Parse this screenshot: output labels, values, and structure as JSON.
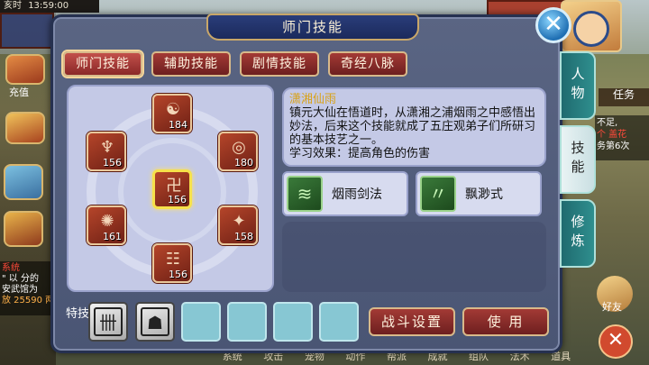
{
  "status_bar": {
    "left_text": "亥时",
    "time": "13:59:00"
  },
  "background": {
    "left_hud_label": "充值",
    "chat_lines": [
      "系统",
      "\" 以 分的",
      "安武馆为",
      "放 25590 两"
    ],
    "right_task_label": "任务",
    "right_notice": [
      "不足,",
      "个 盖花",
      "务第6次"
    ],
    "bottom_menu": [
      "系统",
      "攻击",
      "宠物",
      "动作",
      "帮派",
      "成就",
      "组队",
      "法术",
      "道具"
    ],
    "right_bottom_label": "好友"
  },
  "dialog": {
    "title": "师门技能",
    "close_label": "✕"
  },
  "top_tabs": [
    {
      "label": "师门技能",
      "active": true
    },
    {
      "label": "辅助技能",
      "active": false
    },
    {
      "label": "剧情技能",
      "active": false
    },
    {
      "label": "奇经八脉",
      "active": false
    }
  ],
  "side_tabs": [
    {
      "label": "人物",
      "active": false
    },
    {
      "label": "技能",
      "active": true
    },
    {
      "label": "修炼",
      "active": false
    }
  ],
  "skills": [
    {
      "level": "184",
      "glyph": "☯"
    },
    {
      "level": "156",
      "glyph": "♆"
    },
    {
      "level": "180",
      "glyph": "◎"
    },
    {
      "level": "156",
      "glyph": "卍",
      "selected": true
    },
    {
      "level": "161",
      "glyph": "✺"
    },
    {
      "level": "158",
      "glyph": "✦"
    },
    {
      "level": "156",
      "glyph": "☷"
    }
  ],
  "description": {
    "name": "潇湘仙雨",
    "text": "镇元大仙在悟道时，从潇湘之浦烟雨之中感悟出妙法，后来这个技能就成了五庄观弟子们所研习的基本技艺之一。",
    "effect": "学习效果：提高角色的伤害"
  },
  "sub_skills": [
    {
      "label": "烟雨剑法",
      "icon": "sword-rain-icon"
    },
    {
      "label": "飘渺式",
      "icon": "wind-icon"
    }
  ],
  "special": {
    "label": "特技",
    "slots": [
      "filled",
      "filled",
      "empty",
      "empty",
      "empty",
      "empty"
    ]
  },
  "actions": {
    "battle_settings": "战斗设置",
    "use": "使 用"
  }
}
